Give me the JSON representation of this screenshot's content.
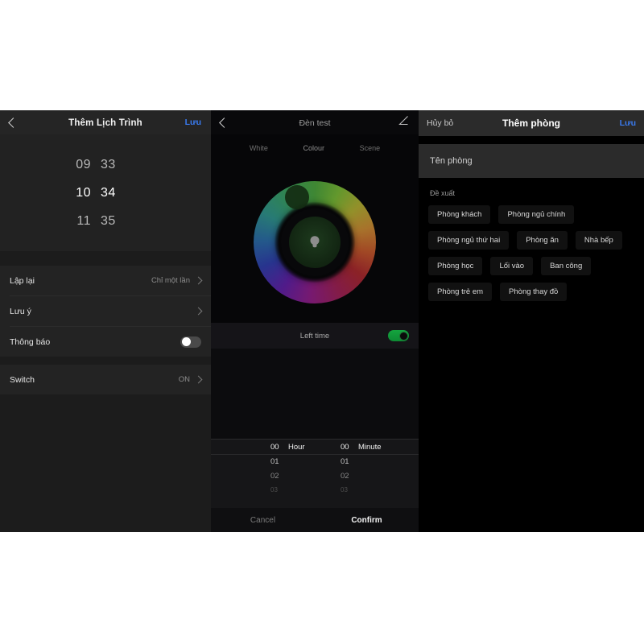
{
  "panel_schedule": {
    "nav": {
      "back_icon": "chevron-left-icon",
      "title": "Thêm Lịch Trình",
      "save_label": "Lưu"
    },
    "time_rows": [
      {
        "hour": "09",
        "minute": "33"
      },
      {
        "hour": "10",
        "minute": "34"
      },
      {
        "hour": "11",
        "minute": "35"
      }
    ],
    "rows": [
      {
        "label": "Lập lại",
        "value": "Chỉ một lần",
        "control": "chevron"
      },
      {
        "label": "Lưu ý",
        "value": "",
        "control": "chevron"
      },
      {
        "label": "Thông báo",
        "value": "",
        "control": "toggle-off"
      }
    ],
    "switch_row": {
      "label": "Switch",
      "value": "ON",
      "control": "chevron"
    }
  },
  "panel_light": {
    "nav": {
      "back_icon": "chevron-left-icon",
      "title": "Đèn test",
      "edit_icon": "pencil-icon"
    },
    "tabs": [
      {
        "label": "White",
        "active": false
      },
      {
        "label": "Colour",
        "active": true
      },
      {
        "label": "Scene",
        "active": false
      }
    ],
    "color_wheel": {
      "center_icon": "lightbulb-icon",
      "handle_name": "color-picker-handle"
    },
    "left_time": {
      "label": "Left time",
      "toggle": "on"
    },
    "picker": {
      "hour_unit": "Hour",
      "minute_unit": "Minute",
      "hour_values": [
        "00",
        "01",
        "02",
        "03"
      ],
      "minute_values": [
        "00",
        "01",
        "02",
        "03"
      ]
    },
    "actions": {
      "cancel": "Cancel",
      "confirm": "Confirm"
    }
  },
  "panel_room": {
    "nav": {
      "cancel_label": "Hủy bỏ",
      "title": "Thêm phòng",
      "save_label": "Lưu"
    },
    "name_input": {
      "placeholder": "Tên phòng",
      "value": ""
    },
    "suggestions_label": "Đề xuất",
    "suggestions": [
      "Phòng khách",
      "Phòng ngủ chính",
      "Phòng ngủ thứ hai",
      "Phòng ăn",
      "Nhà bếp",
      "Phòng học",
      "Lối vào",
      "Ban công",
      "Phòng trẻ em",
      "Phòng thay đồ"
    ]
  },
  "colors": {
    "accent_link": "#3a7bf0",
    "toggle_on": "#15a53f",
    "toggle_off": "#4a4a4a",
    "page_background": "#ffffff"
  }
}
